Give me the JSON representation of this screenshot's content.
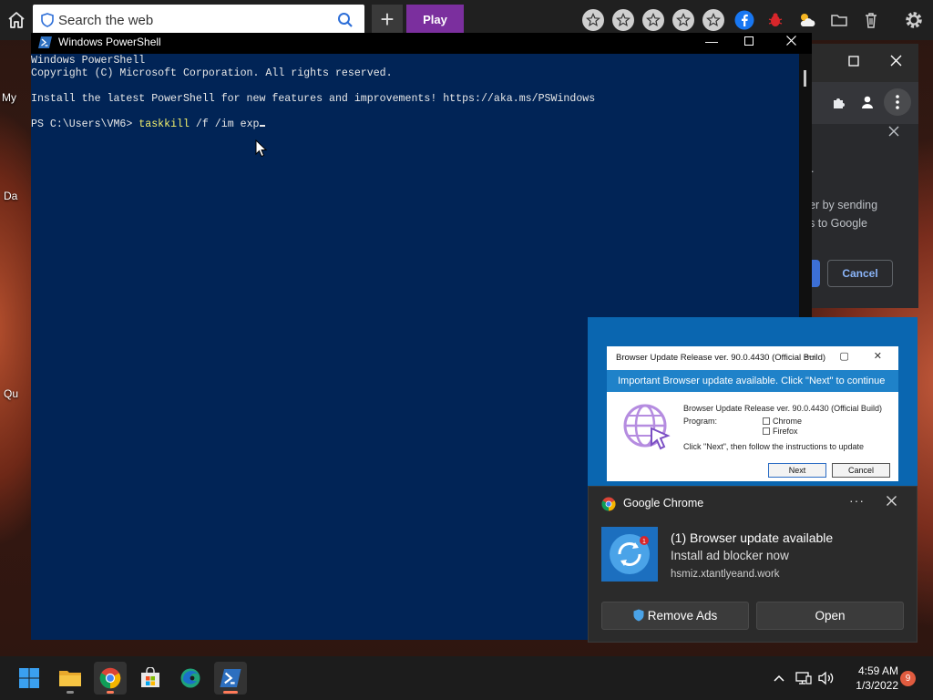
{
  "desktop": {
    "labels": [
      "My",
      "Da",
      "Qu"
    ]
  },
  "toolbar": {
    "search_placeholder": "Search the web",
    "play_label": "Play",
    "extension_icons": [
      "star-icon",
      "star-icon",
      "star-icon",
      "star-icon",
      "star-icon",
      "facebook-icon",
      "bug-icon",
      "weather-icon",
      "folder-icon",
      "trash-icon",
      "gear-icon"
    ]
  },
  "chrome_window": {
    "panel_text_1": "er by sending",
    "panel_text_2": "s to Google",
    "cancel_label": "Cancel"
  },
  "powershell": {
    "title": "Windows PowerShell",
    "lines": [
      "Windows PowerShell",
      "Copyright (C) Microsoft Corporation. All rights reserved.",
      "",
      "Install the latest PowerShell for new features and improvements! https://aka.ms/PSWindows",
      ""
    ],
    "prompt": "PS C:\\Users\\VM6> ",
    "command": "taskkill",
    "args": " /f /im exp"
  },
  "fake_update": {
    "title": "Browser Update Release ver. 90.0.4430 (Official Build)",
    "banner": "Important Browser update available. Click \"Next\" to continue",
    "heading": "Browser Update Release ver. 90.0.4430 (Official Build)",
    "program_label": "Program:",
    "options": [
      "Chrome",
      "Firefox"
    ],
    "instruction": "Click \"Next\", then follow the instructions to update",
    "next_label": "Next",
    "cancel_label": "Cancel"
  },
  "notification": {
    "app_name": "Google Chrome",
    "more_label": "···",
    "title": "(1) Browser update available",
    "body": "Install ad blocker now",
    "source": "hsmiz.xtantlyeand.work",
    "icon_badge": "1",
    "remove_ads_label": "Remove Ads",
    "open_label": "Open"
  },
  "taskbar": {
    "apps": [
      "windows-start-icon",
      "file-explorer-icon",
      "chrome-icon",
      "store-icon",
      "edge-icon",
      "powershell-icon"
    ],
    "time": "4:59 AM",
    "date": "1/3/2022",
    "notification_count": "9"
  },
  "colors": {
    "ps_background": "#012456",
    "ps_command": "#f3f06c",
    "play_button": "#7b2f9e",
    "chrome_accent": "#8ab4f8",
    "badge": "#e05b3f"
  }
}
